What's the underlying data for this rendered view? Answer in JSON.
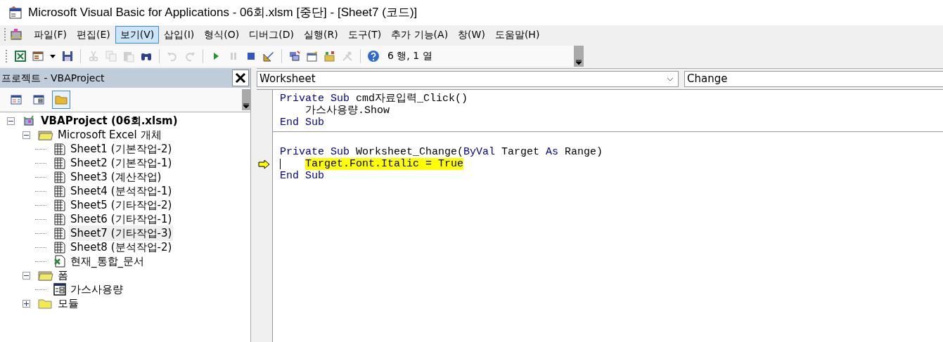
{
  "window": {
    "title": "Microsoft Visual Basic for Applications - 06회.xlsm [중단] - [Sheet7 (코드)]"
  },
  "menu": [
    {
      "label": "파일(F)",
      "selected": false
    },
    {
      "label": "편집(E)",
      "selected": false
    },
    {
      "label": "보기(V)",
      "selected": true
    },
    {
      "label": "삽입(I)",
      "selected": false
    },
    {
      "label": "형식(O)",
      "selected": false
    },
    {
      "label": "디버그(D)",
      "selected": false
    },
    {
      "label": "실행(R)",
      "selected": false
    },
    {
      "label": "도구(T)",
      "selected": false
    },
    {
      "label": "추가 기능(A)",
      "selected": false
    },
    {
      "label": "창(W)",
      "selected": false
    },
    {
      "label": "도움말(H)",
      "selected": false
    }
  ],
  "toolbar": {
    "buttons": [
      {
        "kind": "excel",
        "disabled": false
      },
      {
        "kind": "insert",
        "disabled": false
      },
      {
        "kind": "dropdown",
        "disabled": false
      },
      {
        "kind": "save",
        "disabled": false
      },
      {
        "kind": "sep"
      },
      {
        "kind": "cut",
        "disabled": true
      },
      {
        "kind": "copy",
        "disabled": true
      },
      {
        "kind": "paste",
        "disabled": true
      },
      {
        "kind": "find",
        "disabled": false
      },
      {
        "kind": "sep"
      },
      {
        "kind": "undo",
        "disabled": true
      },
      {
        "kind": "redo",
        "disabled": true
      },
      {
        "kind": "sep"
      },
      {
        "kind": "run",
        "disabled": false
      },
      {
        "kind": "pause",
        "disabled": true
      },
      {
        "kind": "stop",
        "disabled": false
      },
      {
        "kind": "design",
        "disabled": false
      },
      {
        "kind": "sep"
      },
      {
        "kind": "project",
        "disabled": false
      },
      {
        "kind": "properties",
        "disabled": false
      },
      {
        "kind": "objects",
        "disabled": false
      },
      {
        "kind": "tools",
        "disabled": true
      },
      {
        "kind": "sep"
      },
      {
        "kind": "help",
        "disabled": false
      }
    ],
    "position": "6 행, 1 열"
  },
  "project_panel": {
    "title": "프로젝트 - VBAProject",
    "buttons": [
      {
        "kind": "view-code",
        "selected": false
      },
      {
        "kind": "view-object",
        "selected": false
      },
      {
        "kind": "toggle-folders",
        "selected": true
      }
    ],
    "tree": [
      {
        "label": "VBAProject (06회.xlsm)",
        "kind": "project",
        "expanded": true,
        "selected": false,
        "children": [
          {
            "label": "Microsoft Excel 개체",
            "kind": "folder-open",
            "expanded": true,
            "selected": false,
            "children": [
              {
                "label": "Sheet1 (기본작업-2)",
                "kind": "sheet",
                "selected": false
              },
              {
                "label": "Sheet2 (기본작업-1)",
                "kind": "sheet",
                "selected": false
              },
              {
                "label": "Sheet3 (계산작업)",
                "kind": "sheet",
                "selected": false
              },
              {
                "label": "Sheet4 (분석작업-1)",
                "kind": "sheet",
                "selected": false
              },
              {
                "label": "Sheet5 (기타작업-2)",
                "kind": "sheet",
                "selected": false
              },
              {
                "label": "Sheet6 (기타작업-1)",
                "kind": "sheet",
                "selected": false
              },
              {
                "label": "Sheet7 (기타작업-3)",
                "kind": "sheet",
                "selected": true
              },
              {
                "label": "Sheet8 (분석작업-2)",
                "kind": "sheet",
                "selected": false
              },
              {
                "label": "현재_통합_문서",
                "kind": "workbook",
                "selected": false
              }
            ]
          },
          {
            "label": "폼",
            "kind": "folder-open",
            "expanded": true,
            "selected": false,
            "children": [
              {
                "label": "가스사용량",
                "kind": "form",
                "selected": false
              }
            ]
          },
          {
            "label": "모듈",
            "kind": "folder",
            "expanded": false,
            "selected": false
          }
        ]
      }
    ]
  },
  "code_window": {
    "object_combo": "Worksheet",
    "procedure_combo": "Change",
    "lines": [
      {
        "kind": "code",
        "current": false,
        "indented": false,
        "tokens": [
          {
            "text": "Private Sub ",
            "kind": "keyword"
          },
          {
            "text": "cmd자료입력_Click()",
            "kind": "text"
          }
        ]
      },
      {
        "kind": "code",
        "current": false,
        "indented": true,
        "tokens": [
          {
            "text": "가스사용량.Show",
            "kind": "text"
          }
        ]
      },
      {
        "kind": "code",
        "current": false,
        "indented": false,
        "tokens": [
          {
            "text": "End Sub",
            "kind": "keyword"
          }
        ]
      },
      {
        "kind": "separator"
      },
      {
        "kind": "blank"
      },
      {
        "kind": "code",
        "current": false,
        "indented": false,
        "tokens": [
          {
            "text": "Private Sub ",
            "kind": "keyword"
          },
          {
            "text": "Worksheet_Change(",
            "kind": "text"
          },
          {
            "text": "ByVal",
            "kind": "keyword"
          },
          {
            "text": " Target ",
            "kind": "text"
          },
          {
            "text": "As",
            "kind": "keyword"
          },
          {
            "text": " Range)",
            "kind": "text"
          }
        ]
      },
      {
        "kind": "code",
        "current": true,
        "indented": true,
        "tokens": [
          {
            "text": "Target.Font.Italic = True",
            "kind": "text"
          }
        ]
      },
      {
        "kind": "code",
        "current": false,
        "indented": false,
        "tokens": [
          {
            "text": "End Sub",
            "kind": "keyword"
          }
        ]
      }
    ]
  }
}
